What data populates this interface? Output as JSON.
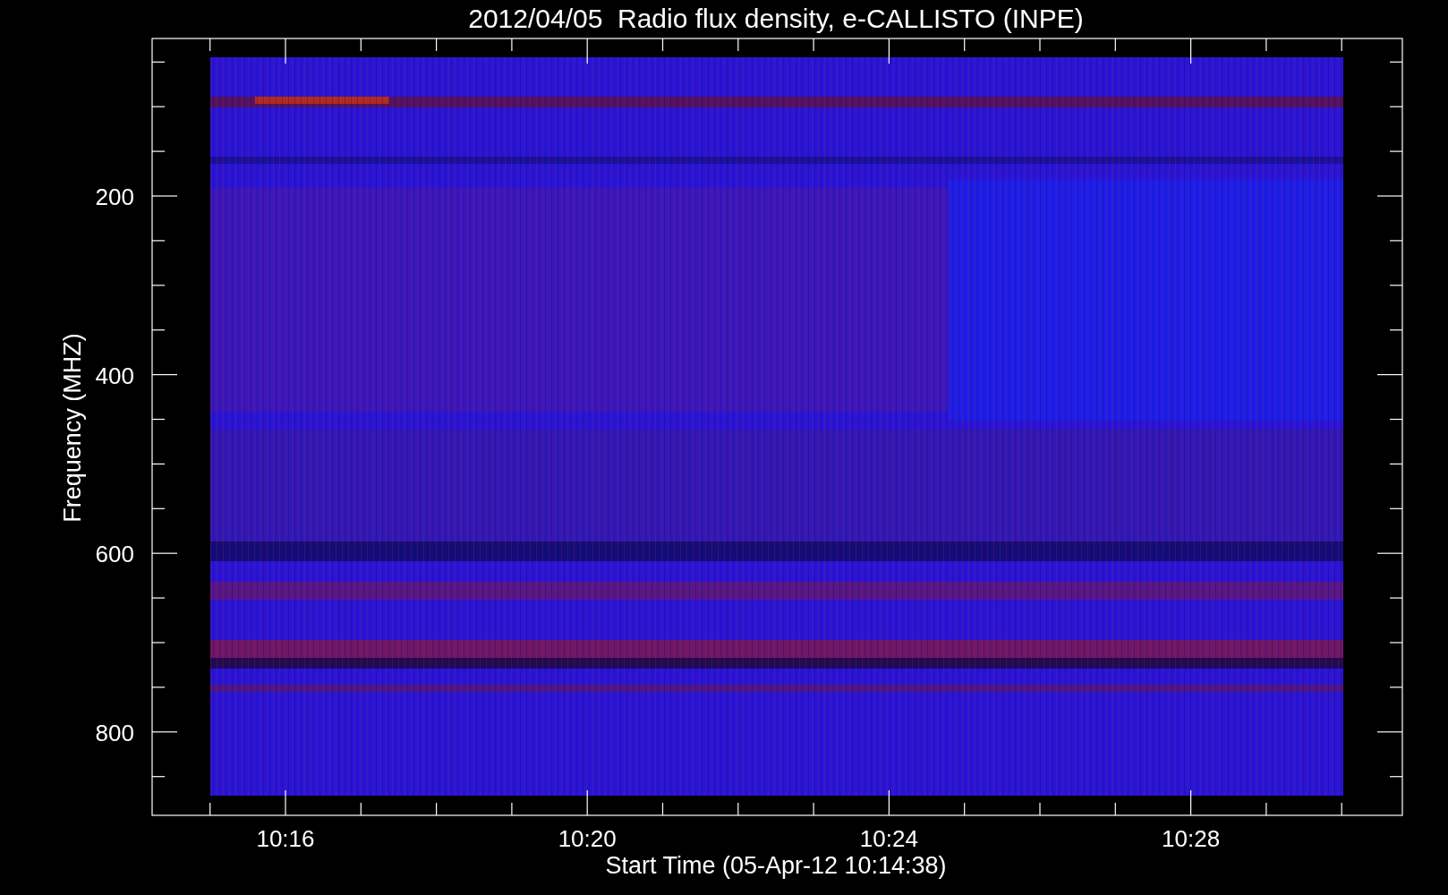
{
  "title": "2012/04/05  Radio flux density, e-CALLISTO (INPE)",
  "y_axis": {
    "label": "Frequency (MHZ)",
    "tick_labels": [
      "200",
      "400",
      "600",
      "800"
    ]
  },
  "x_axis": {
    "label": "Start Time (05-Apr-12 10:14:38)",
    "tick_labels": [
      "10:16",
      "10:20",
      "10:24",
      "10:28"
    ]
  }
}
